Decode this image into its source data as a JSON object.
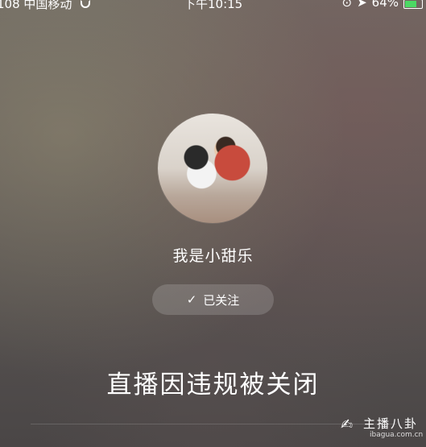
{
  "statusbar": {
    "carrier": "108 中国移动",
    "time": "下午10:15",
    "battery": "64%",
    "battery_level": 0.64,
    "icons": [
      "wifi-icon",
      "lock-rotation-icon",
      "location-icon",
      "battery-icon"
    ]
  },
  "profile": {
    "username": "我是小甜乐",
    "follow_button_label": "已关注",
    "follow_icon": "checkmark-icon"
  },
  "notice": {
    "message": "直播因违规被关闭"
  },
  "watermark": {
    "title": "主播八卦",
    "url": "ibagua.com.cn"
  }
}
